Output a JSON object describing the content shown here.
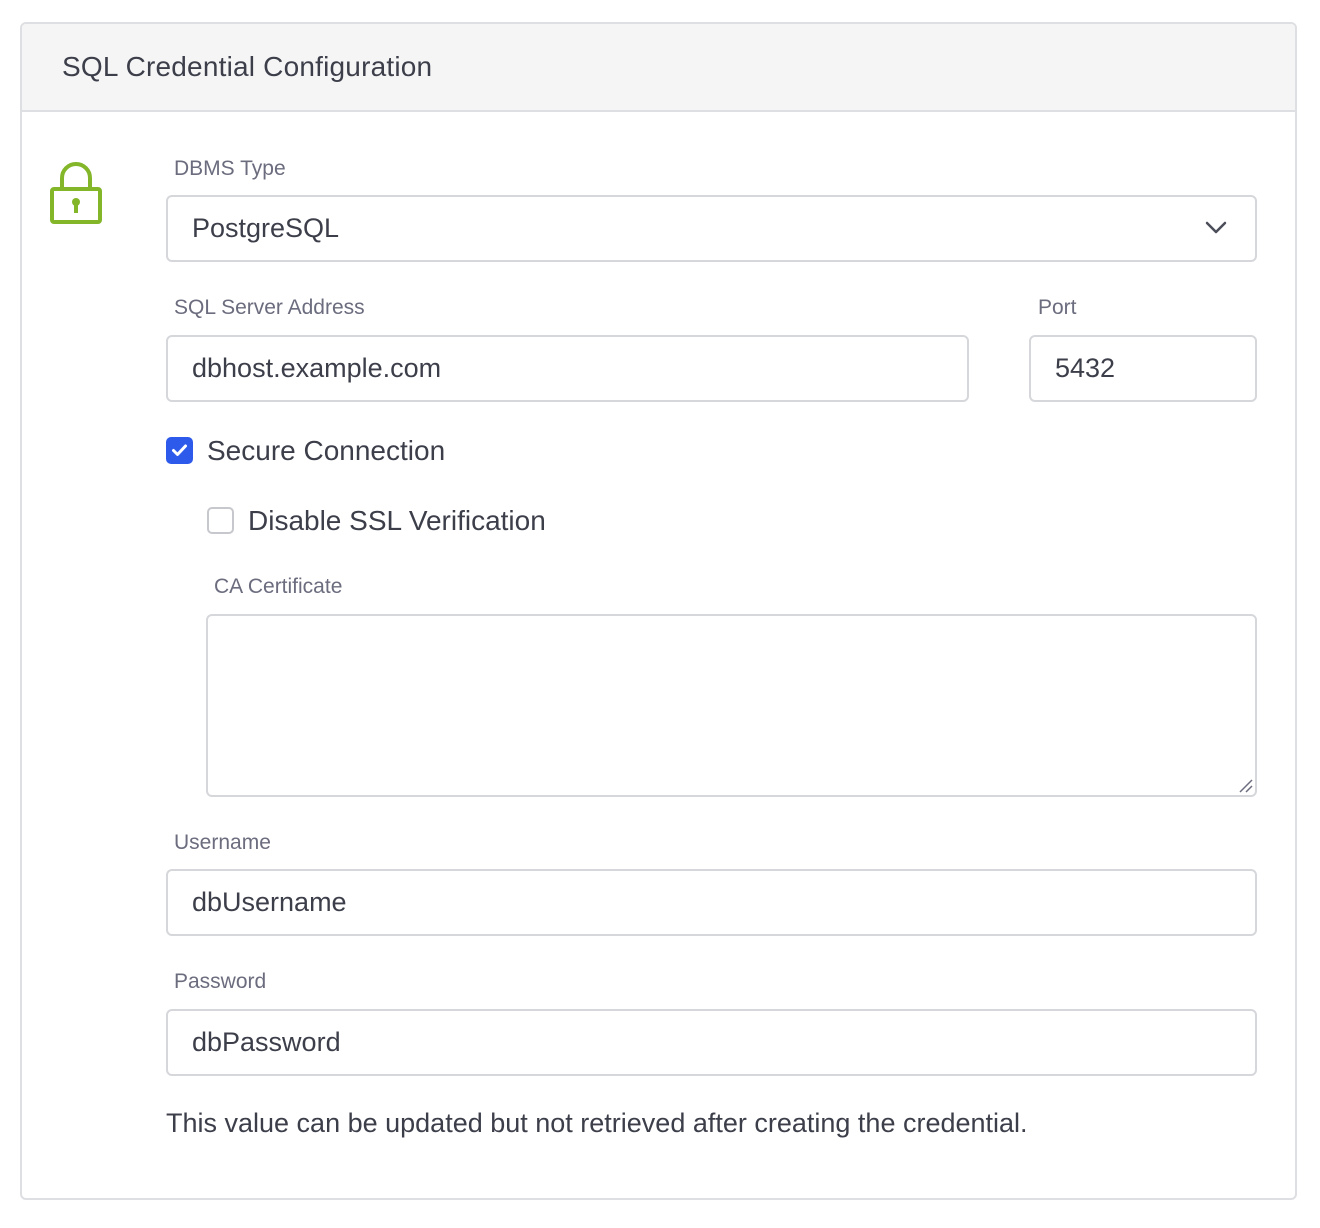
{
  "panel": {
    "title": "SQL Credential Configuration"
  },
  "icons": {
    "lock": "lock-icon",
    "chevron": "chevron-down-icon",
    "check": "check-icon",
    "resize": "resize-handle-icon"
  },
  "colors": {
    "lock_green": "#84b62a",
    "checkbox_blue": "#2e5aeb"
  },
  "form": {
    "dbms_type": {
      "label": "DBMS Type",
      "value": "PostgreSQL"
    },
    "server_address": {
      "label": "SQL Server Address",
      "value": "dbhost.example.com"
    },
    "port": {
      "label": "Port",
      "value": "5432"
    },
    "secure_connection": {
      "label": "Secure Connection",
      "checked": true
    },
    "disable_ssl": {
      "label": "Disable SSL Verification",
      "checked": false
    },
    "ca_certificate": {
      "label": "CA Certificate",
      "value": ""
    },
    "username": {
      "label": "Username",
      "value": "dbUsername"
    },
    "password": {
      "label": "Password",
      "value": "dbPassword",
      "helper": "This value can be updated but not retrieved after creating the credential."
    }
  }
}
